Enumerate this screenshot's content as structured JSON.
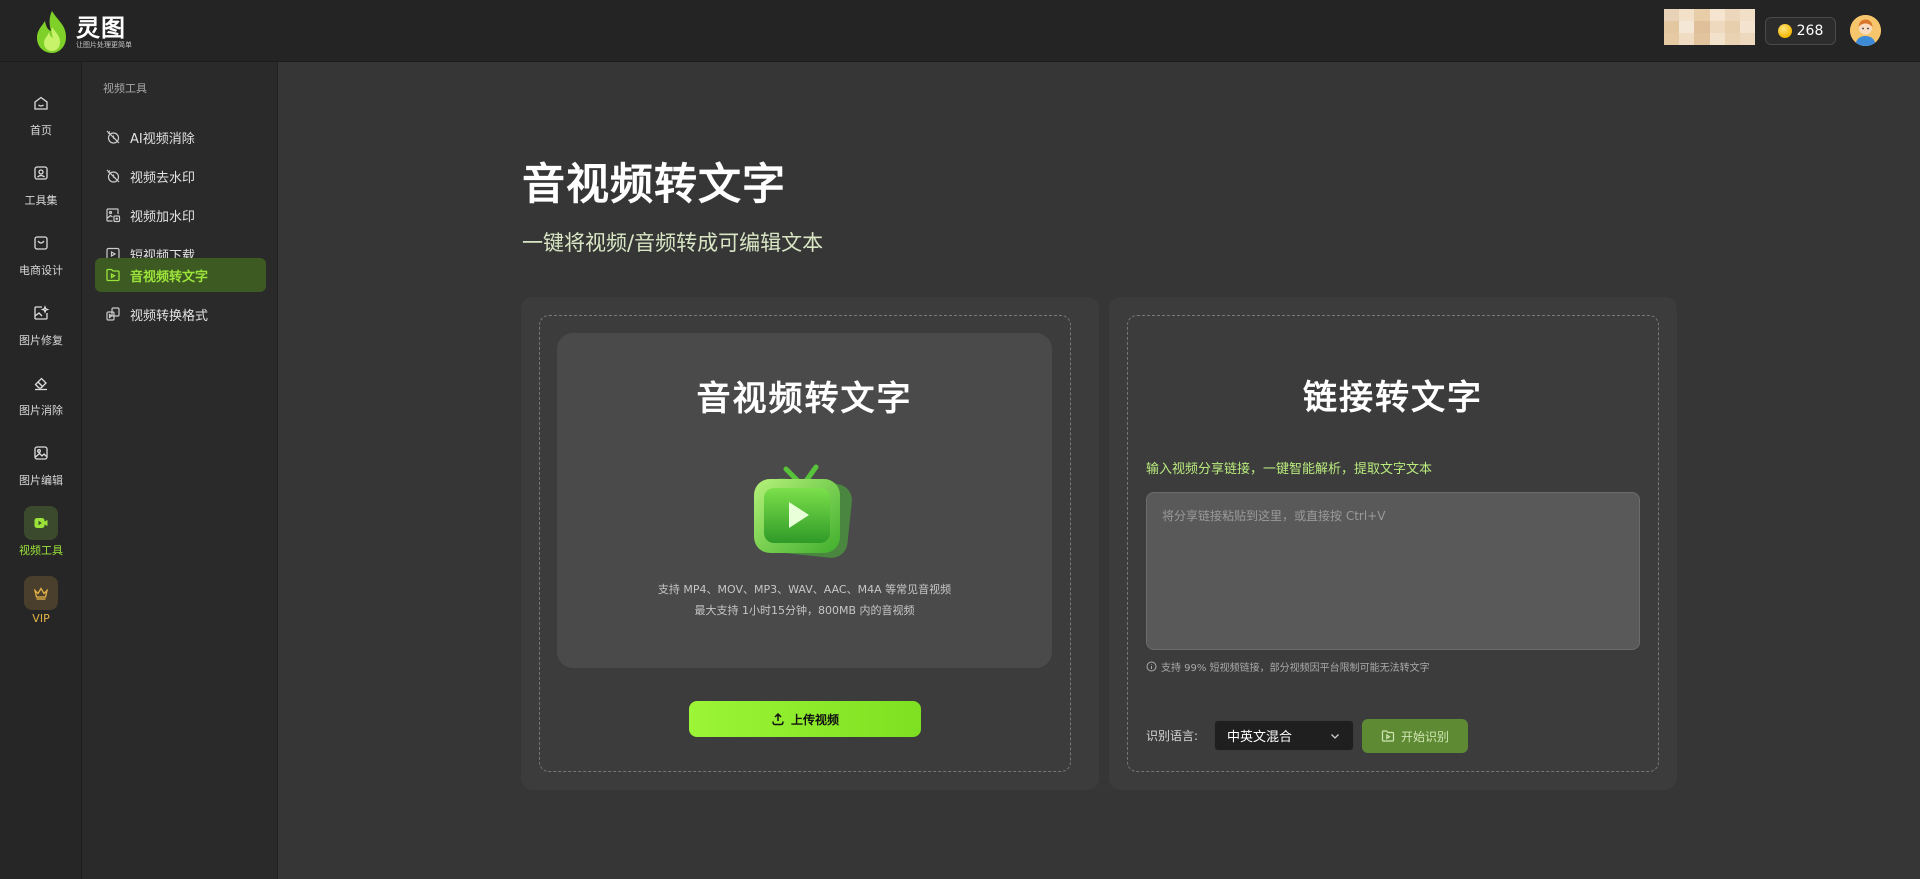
{
  "header": {
    "logo_name": "灵图",
    "logo_slogan": "让图片处理更简单",
    "coin_count": "268"
  },
  "sidenav": {
    "items": [
      {
        "label": "首页",
        "icon": "home-icon"
      },
      {
        "label": "工具集",
        "icon": "toolbox-icon"
      },
      {
        "label": "电商设计",
        "icon": "shopping-bag-icon"
      },
      {
        "label": "图片修复",
        "icon": "image-repair-icon"
      },
      {
        "label": "图片消除",
        "icon": "eraser-icon"
      },
      {
        "label": "图片编辑",
        "icon": "image-edit-icon"
      },
      {
        "label": "视频工具",
        "icon": "video-icon",
        "active": true
      },
      {
        "label": "VIP",
        "icon": "crown-icon"
      }
    ]
  },
  "subnav": {
    "title": "视频工具",
    "items": [
      {
        "label": "AI视频消除",
        "icon": "video-erase-icon"
      },
      {
        "label": "视频去水印",
        "icon": "watermark-remove-icon"
      },
      {
        "label": "视频加水印",
        "icon": "watermark-add-icon"
      },
      {
        "label": "短视频下载",
        "icon": "download-video-icon"
      },
      {
        "label": "音视频转文字",
        "icon": "video-to-text-icon",
        "active": true
      },
      {
        "label": "视频转换格式",
        "icon": "format-convert-icon"
      }
    ]
  },
  "main": {
    "title": "音视频转文字",
    "subtitle": "一键将视频/音频转成可编辑文本",
    "upload_card": {
      "heading": "音视频转文字",
      "formats_note": "支持 MP4、MOV、MP3、WAV、AAC、M4A 等常见音视频",
      "size_note": "最大支持 1小时15分钟，800MB 内的音视频",
      "upload_label": "上传视频"
    },
    "link_card": {
      "heading": "链接转文字",
      "prompt": "输入视频分享链接，一键智能解析，提取文字文本",
      "placeholder": "将分享链接粘贴到这里，或直接按 Ctrl+V",
      "note": "支持 99% 短视频链接，部分视频因平台限制可能无法转文字",
      "lang_label": "识别语言:",
      "lang_value": "中英文混合",
      "start_label": "开始识别"
    }
  },
  "colors": {
    "accent": "#9cf536",
    "active_text": "#9be33a",
    "vip": "#e6b447",
    "background": "#363636"
  }
}
